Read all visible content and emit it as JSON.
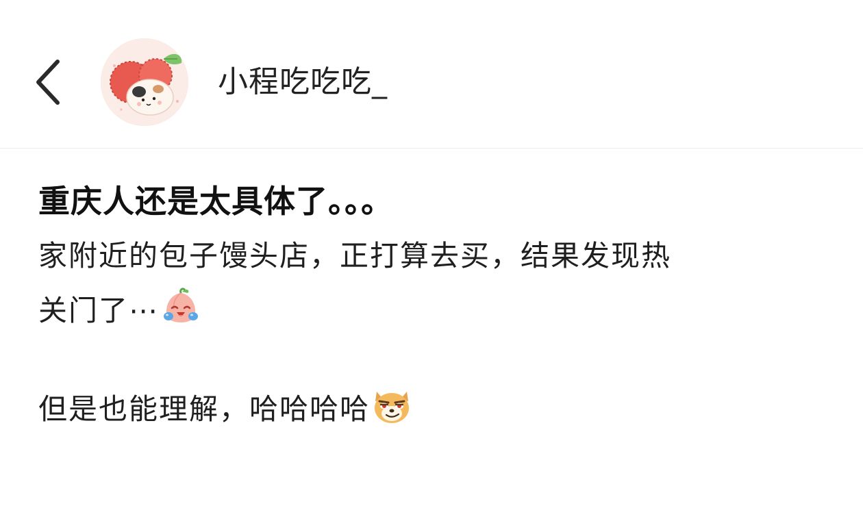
{
  "header": {
    "back_icon": "chevron-left-icon",
    "avatar_icon": "cartoon-avatar-lychee-cat",
    "username": "小程吃吃吃_"
  },
  "post": {
    "title": "重庆人还是太具体了。。。",
    "paragraph1_line1": "家附近的包子馒头店，正打算去买，结果发现热",
    "paragraph1_line2": "关门了⋯",
    "paragraph1_emoji": "crying-peach-emoji",
    "paragraph2": "但是也能理解，哈哈哈哈",
    "paragraph2_emoji": "smirking-dog-emoji"
  },
  "colors": {
    "background": "#ffffff",
    "text": "#1f1f1f",
    "divider": "#ececec"
  }
}
